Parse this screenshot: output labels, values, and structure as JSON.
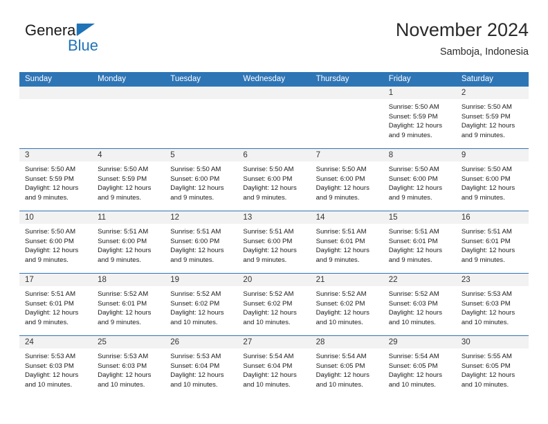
{
  "logo": {
    "word_top": "General",
    "word_bottom": "Blue",
    "accent_color": "#1f73b7"
  },
  "header": {
    "title": "November 2024",
    "subtitle": "Samboja, Indonesia"
  },
  "theme": {
    "header_blue": "#2e75b6",
    "date_strip_gray": "#f2f2f2",
    "text_dark": "#1a1a1a"
  },
  "weekday_headers": [
    "Sunday",
    "Monday",
    "Tuesday",
    "Wednesday",
    "Thursday",
    "Friday",
    "Saturday"
  ],
  "weeks": [
    [
      {
        "day": "",
        "lines": []
      },
      {
        "day": "",
        "lines": []
      },
      {
        "day": "",
        "lines": []
      },
      {
        "day": "",
        "lines": []
      },
      {
        "day": "",
        "lines": []
      },
      {
        "day": "1",
        "lines": [
          "Sunrise: 5:50 AM",
          "Sunset: 5:59 PM",
          "Daylight: 12 hours",
          "and 9 minutes."
        ]
      },
      {
        "day": "2",
        "lines": [
          "Sunrise: 5:50 AM",
          "Sunset: 5:59 PM",
          "Daylight: 12 hours",
          "and 9 minutes."
        ]
      }
    ],
    [
      {
        "day": "3",
        "lines": [
          "Sunrise: 5:50 AM",
          "Sunset: 5:59 PM",
          "Daylight: 12 hours",
          "and 9 minutes."
        ]
      },
      {
        "day": "4",
        "lines": [
          "Sunrise: 5:50 AM",
          "Sunset: 5:59 PM",
          "Daylight: 12 hours",
          "and 9 minutes."
        ]
      },
      {
        "day": "5",
        "lines": [
          "Sunrise: 5:50 AM",
          "Sunset: 6:00 PM",
          "Daylight: 12 hours",
          "and 9 minutes."
        ]
      },
      {
        "day": "6",
        "lines": [
          "Sunrise: 5:50 AM",
          "Sunset: 6:00 PM",
          "Daylight: 12 hours",
          "and 9 minutes."
        ]
      },
      {
        "day": "7",
        "lines": [
          "Sunrise: 5:50 AM",
          "Sunset: 6:00 PM",
          "Daylight: 12 hours",
          "and 9 minutes."
        ]
      },
      {
        "day": "8",
        "lines": [
          "Sunrise: 5:50 AM",
          "Sunset: 6:00 PM",
          "Daylight: 12 hours",
          "and 9 minutes."
        ]
      },
      {
        "day": "9",
        "lines": [
          "Sunrise: 5:50 AM",
          "Sunset: 6:00 PM",
          "Daylight: 12 hours",
          "and 9 minutes."
        ]
      }
    ],
    [
      {
        "day": "10",
        "lines": [
          "Sunrise: 5:50 AM",
          "Sunset: 6:00 PM",
          "Daylight: 12 hours",
          "and 9 minutes."
        ]
      },
      {
        "day": "11",
        "lines": [
          "Sunrise: 5:51 AM",
          "Sunset: 6:00 PM",
          "Daylight: 12 hours",
          "and 9 minutes."
        ]
      },
      {
        "day": "12",
        "lines": [
          "Sunrise: 5:51 AM",
          "Sunset: 6:00 PM",
          "Daylight: 12 hours",
          "and 9 minutes."
        ]
      },
      {
        "day": "13",
        "lines": [
          "Sunrise: 5:51 AM",
          "Sunset: 6:00 PM",
          "Daylight: 12 hours",
          "and 9 minutes."
        ]
      },
      {
        "day": "14",
        "lines": [
          "Sunrise: 5:51 AM",
          "Sunset: 6:01 PM",
          "Daylight: 12 hours",
          "and 9 minutes."
        ]
      },
      {
        "day": "15",
        "lines": [
          "Sunrise: 5:51 AM",
          "Sunset: 6:01 PM",
          "Daylight: 12 hours",
          "and 9 minutes."
        ]
      },
      {
        "day": "16",
        "lines": [
          "Sunrise: 5:51 AM",
          "Sunset: 6:01 PM",
          "Daylight: 12 hours",
          "and 9 minutes."
        ]
      }
    ],
    [
      {
        "day": "17",
        "lines": [
          "Sunrise: 5:51 AM",
          "Sunset: 6:01 PM",
          "Daylight: 12 hours",
          "and 9 minutes."
        ]
      },
      {
        "day": "18",
        "lines": [
          "Sunrise: 5:52 AM",
          "Sunset: 6:01 PM",
          "Daylight: 12 hours",
          "and 9 minutes."
        ]
      },
      {
        "day": "19",
        "lines": [
          "Sunrise: 5:52 AM",
          "Sunset: 6:02 PM",
          "Daylight: 12 hours",
          "and 10 minutes."
        ]
      },
      {
        "day": "20",
        "lines": [
          "Sunrise: 5:52 AM",
          "Sunset: 6:02 PM",
          "Daylight: 12 hours",
          "and 10 minutes."
        ]
      },
      {
        "day": "21",
        "lines": [
          "Sunrise: 5:52 AM",
          "Sunset: 6:02 PM",
          "Daylight: 12 hours",
          "and 10 minutes."
        ]
      },
      {
        "day": "22",
        "lines": [
          "Sunrise: 5:52 AM",
          "Sunset: 6:03 PM",
          "Daylight: 12 hours",
          "and 10 minutes."
        ]
      },
      {
        "day": "23",
        "lines": [
          "Sunrise: 5:53 AM",
          "Sunset: 6:03 PM",
          "Daylight: 12 hours",
          "and 10 minutes."
        ]
      }
    ],
    [
      {
        "day": "24",
        "lines": [
          "Sunrise: 5:53 AM",
          "Sunset: 6:03 PM",
          "Daylight: 12 hours",
          "and 10 minutes."
        ]
      },
      {
        "day": "25",
        "lines": [
          "Sunrise: 5:53 AM",
          "Sunset: 6:03 PM",
          "Daylight: 12 hours",
          "and 10 minutes."
        ]
      },
      {
        "day": "26",
        "lines": [
          "Sunrise: 5:53 AM",
          "Sunset: 6:04 PM",
          "Daylight: 12 hours",
          "and 10 minutes."
        ]
      },
      {
        "day": "27",
        "lines": [
          "Sunrise: 5:54 AM",
          "Sunset: 6:04 PM",
          "Daylight: 12 hours",
          "and 10 minutes."
        ]
      },
      {
        "day": "28",
        "lines": [
          "Sunrise: 5:54 AM",
          "Sunset: 6:05 PM",
          "Daylight: 12 hours",
          "and 10 minutes."
        ]
      },
      {
        "day": "29",
        "lines": [
          "Sunrise: 5:54 AM",
          "Sunset: 6:05 PM",
          "Daylight: 12 hours",
          "and 10 minutes."
        ]
      },
      {
        "day": "30",
        "lines": [
          "Sunrise: 5:55 AM",
          "Sunset: 6:05 PM",
          "Daylight: 12 hours",
          "and 10 minutes."
        ]
      }
    ]
  ]
}
